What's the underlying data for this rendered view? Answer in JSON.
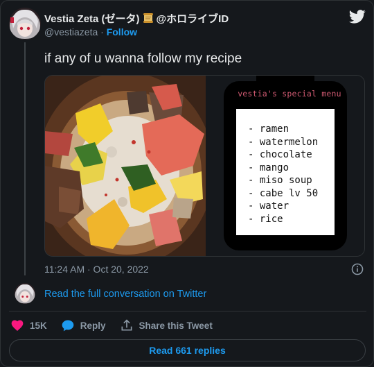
{
  "author": {
    "display_name": "Vestia Zeta (ゼータ)",
    "org_suffix": "@ホロライブID",
    "handle": "@vestiazeta",
    "separator": "·",
    "follow_label": "Follow"
  },
  "tweet": {
    "text": "if any of u wanna follow my recipe",
    "timestamp": "11:24 AM · Oct 20, 2022"
  },
  "media": {
    "menu_title": "vestia's special menu",
    "menu_items": [
      "- ramen",
      "- watermelon",
      "- chocolate",
      "- mango",
      "- miso soup",
      "- cabe lv 50",
      "- water",
      "- rice"
    ]
  },
  "conversation_link": "Read the full conversation on Twitter",
  "actions": {
    "like_count": "15K",
    "reply_label": "Reply",
    "share_label": "Share this Tweet"
  },
  "read_replies_label": "Read 661 replies",
  "colors": {
    "background": "#15181c",
    "accent": "#1d9bf0",
    "like": "#f91880",
    "muted": "#8b98a5"
  },
  "icons": [
    "twitter-bird-icon",
    "scroll-emoji-icon",
    "info-icon",
    "heart-icon",
    "reply-bubble-icon",
    "share-icon"
  ]
}
